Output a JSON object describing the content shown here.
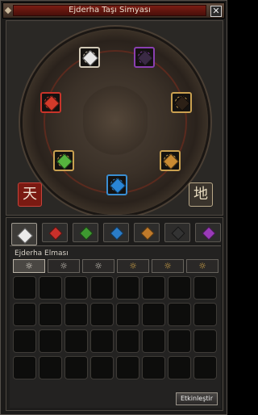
{
  "window": {
    "title": "Ejderha Taşı Simyası",
    "close_glyph": "✕"
  },
  "altar": {
    "gems": [
      {
        "name": "diamond",
        "icon": "diamond-gem-icon",
        "color": "#e6e6e6",
        "frame": "#d0c7b5"
      },
      {
        "name": "onyx",
        "icon": "onyx-gem-icon",
        "color": "#3a2a44",
        "frame": "#8a3fb0"
      },
      {
        "name": "ruby",
        "icon": "ruby-gem-icon",
        "color": "#d23a2a",
        "frame": "#c8342a"
      },
      {
        "name": "garnet",
        "icon": "garnet-gem-icon",
        "color": "#2c2016",
        "frame": "#c9a050"
      },
      {
        "name": "jade",
        "icon": "jade-gem-icon",
        "color": "#56b43e",
        "frame": "#c9a050"
      },
      {
        "name": "amber",
        "icon": "amber-gem-icon",
        "color": "#c98a32",
        "frame": "#c9a050"
      },
      {
        "name": "sapphire",
        "icon": "sapphire-gem-icon",
        "color": "#2a86d6",
        "frame": "#3a8ed2"
      }
    ],
    "seal_heaven": "天",
    "seal_earth": "地"
  },
  "tabs": [
    {
      "name": "diamond",
      "icon": "diamond-gem-icon",
      "color": "#eaeaea"
    },
    {
      "name": "ruby",
      "icon": "ruby-gem-icon",
      "color": "#c8302a"
    },
    {
      "name": "jade",
      "icon": "jade-gem-icon",
      "color": "#3e9a30"
    },
    {
      "name": "sapphire",
      "icon": "sapphire-gem-icon",
      "color": "#2a7cc8"
    },
    {
      "name": "amber",
      "icon": "amber-gem-icon",
      "color": "#c07a2a"
    },
    {
      "name": "onyx",
      "icon": "onyx-gem-icon",
      "color": "#333333"
    },
    {
      "name": "amethyst",
      "icon": "amethyst-gem-icon",
      "color": "#9a3ab8"
    }
  ],
  "active_tab": 0,
  "section": {
    "label": "Ejderha Elması",
    "options": [
      {
        "glyph": "☼",
        "icon": "sun-emblem-icon",
        "color": "#e8e3d8"
      },
      {
        "glyph": "☼",
        "icon": "sun-emblem-icon",
        "color": "#cfcac0"
      },
      {
        "glyph": "☼",
        "icon": "sun-emblem-icon",
        "color": "#cfcac0"
      },
      {
        "glyph": "☼",
        "icon": "sun-emblem-icon",
        "color": "#d8a948"
      },
      {
        "glyph": "☼",
        "icon": "sun-emblem-icon",
        "color": "#d8a948"
      },
      {
        "glyph": "☼",
        "icon": "sun-emblem-icon",
        "color": "#d8a948"
      }
    ],
    "selected_option": 0,
    "grid": {
      "rows": 4,
      "cols": 8
    }
  },
  "activate_label": "Etkinleştir"
}
